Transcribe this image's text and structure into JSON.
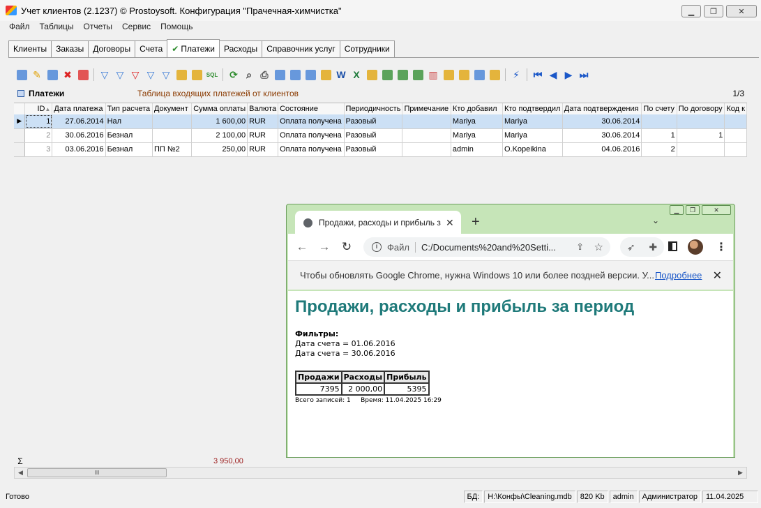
{
  "window": {
    "title": "Учет клиентов (2.1237) © Prostoysoft. Конфигурация \"Прачечная-химчистка\""
  },
  "menu": [
    "Файл",
    "Таблицы",
    "Отчеты",
    "Сервис",
    "Помощь"
  ],
  "tabs": [
    {
      "label": "Клиенты",
      "active": false
    },
    {
      "label": "Заказы",
      "active": false
    },
    {
      "label": "Договоры",
      "active": false
    },
    {
      "label": "Счета",
      "active": false
    },
    {
      "label": "Платежи",
      "active": true
    },
    {
      "label": "Расходы",
      "active": false
    },
    {
      "label": "Справочник услуг",
      "active": false
    },
    {
      "label": "Сотрудники",
      "active": false
    }
  ],
  "toolbar_icons": [
    "add-icon",
    "edit-icon",
    "copy-icon",
    "delete-icon",
    "delete-all-icon",
    "filter-icon",
    "filter-add-icon",
    "filter-remove-icon",
    "filter-clear-icon",
    "filter-edit-icon",
    "sort-icon",
    "group-icon",
    "sql-icon",
    "refresh-icon",
    "find-icon",
    "print-icon",
    "preview-icon",
    "export-icon",
    "export2-icon",
    "export3-icon",
    "word-icon",
    "excel-icon",
    "import-icon",
    "csv-icon",
    "txt-icon",
    "html-icon",
    "chart-icon",
    "notes-icon",
    "columns-icon",
    "grid-icon",
    "settings-icon",
    "flash-icon",
    "first-icon",
    "prev-icon",
    "next-icon",
    "last-icon"
  ],
  "grid": {
    "name": "Платежи",
    "description": "Таблица входящих платежей от клиентов",
    "pager": "1/3",
    "columns": [
      "ID",
      "Дата платежа",
      "Тип расчета",
      "Документ",
      "Сумма оплаты",
      "Валюта",
      "Состояние",
      "Периодичность",
      "Примечание",
      "Кто добавил",
      "Кто подтвердил",
      "Дата подтверждения",
      "По счету",
      "По договору",
      "Код к"
    ],
    "rows": [
      {
        "id": "1",
        "date": "27.06.2014",
        "type": "Нал",
        "doc": "",
        "sum": "1 600,00",
        "cur": "RUR",
        "state": "Оплата получена",
        "period": "Разовый",
        "note": "",
        "added": "Mariya",
        "confirmed": "Mariya",
        "cdate": "30.06.2014",
        "invoice": "",
        "contract": "",
        "code": "",
        "selected": true
      },
      {
        "id": "2",
        "date": "30.06.2016",
        "type": "Безнал",
        "doc": "",
        "sum": "2 100,00",
        "cur": "RUR",
        "state": "Оплата получена",
        "period": "Разовый",
        "note": "",
        "added": "Mariya",
        "confirmed": "Mariya",
        "cdate": "30.06.2014",
        "invoice": "1",
        "contract": "1",
        "code": "",
        "selected": false
      },
      {
        "id": "3",
        "date": "03.06.2016",
        "type": "Безнал",
        "doc": "ПП №2",
        "sum": "250,00",
        "cur": "RUR",
        "state": "Оплата получена",
        "period": "Разовый",
        "note": "",
        "added": "admin",
        "confirmed": "O.Kopeikina",
        "cdate": "04.06.2016",
        "invoice": "2",
        "contract": "",
        "code": "",
        "selected": false
      }
    ],
    "sum_symbol": "Σ",
    "sum_total": "3 950,00"
  },
  "status": {
    "ready": "Готово",
    "db_label": "БД:",
    "db_path": "H:\\Конфы\\Cleaning.mdb",
    "db_size": "820 Kb",
    "user": "admin",
    "role": "Администратор",
    "date": "11.04.2025"
  },
  "browser": {
    "tab_title": "Продажи, расходы и прибыль з",
    "scheme": "Файл",
    "url": "C:/Documents%20and%20Setti...",
    "infobar_text": "Чтобы обновлять Google Chrome, нужна Windows 10 или более поздней версии. У...",
    "infobar_link": "Подробнее",
    "report": {
      "title": "Продажи, расходы и прибыль за период",
      "filters_label": "Фильтры:",
      "filters": [
        "Дата счета = 01.06.2016",
        "Дата счета = 30.06.2016"
      ],
      "headers": [
        "Продажи",
        "Расходы",
        "Прибыль"
      ],
      "values": [
        "7395",
        "2 000,00",
        "5395"
      ],
      "total_records": "Всего записей: 1",
      "time": "Время: 11.04.2025 16:29"
    }
  }
}
